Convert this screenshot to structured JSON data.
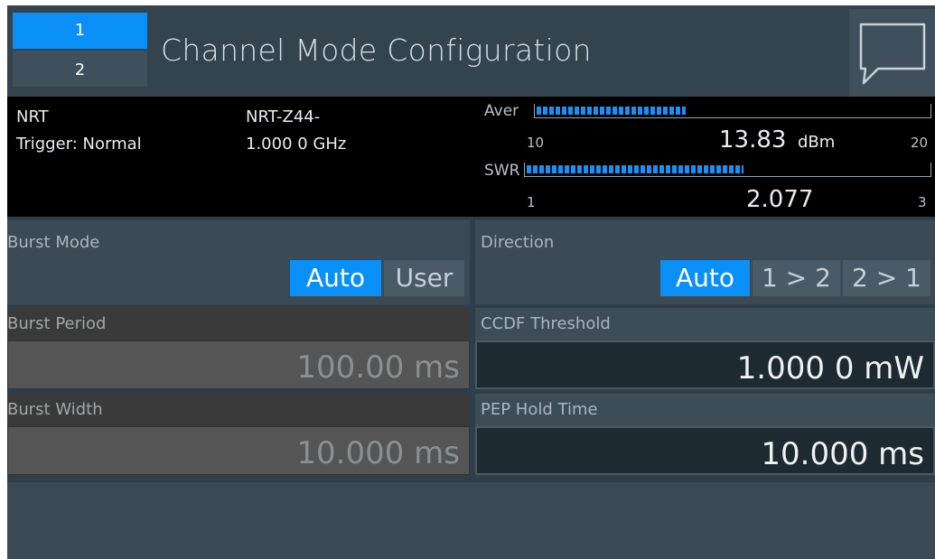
{
  "header": {
    "channels": [
      "1",
      "2"
    ],
    "title": "Channel Mode Configuration",
    "message_icon": "speech-bubble-icon"
  },
  "status": {
    "sensor_name": "NRT",
    "trigger": "Trigger: Normal",
    "sensor_model": "NRT-Z44-",
    "frequency": "1.000 0 GHz",
    "meters": [
      {
        "label": "Aver",
        "min": "10",
        "max": "20",
        "value": "13.83",
        "unit": "dBm",
        "fill_fraction": 0.38
      },
      {
        "label": "SWR",
        "min": "1",
        "max": "3",
        "value": "2.077",
        "unit": "",
        "fill_fraction": 0.54
      }
    ]
  },
  "burst_mode": {
    "label": "Burst Mode",
    "options": [
      "Auto",
      "User"
    ],
    "selected": "Auto"
  },
  "direction": {
    "label": "Direction",
    "options": [
      "Auto",
      "1 > 2",
      "2 > 1"
    ],
    "selected": "Auto"
  },
  "burst_period": {
    "label": "Burst Period",
    "value": "100.00 ms"
  },
  "burst_width": {
    "label": "Burst Width",
    "value": "10.000 ms"
  },
  "ccdf_threshold": {
    "label": "CCDF Threshold",
    "value": "1.000 0 mW"
  },
  "pep_hold_time": {
    "label": "PEP Hold Time",
    "value": "10.000 ms"
  },
  "colors": {
    "accent": "#0a8ff7",
    "background": "#2f3f4a",
    "status_bg": "#000000",
    "disabled_field": "#555555"
  }
}
